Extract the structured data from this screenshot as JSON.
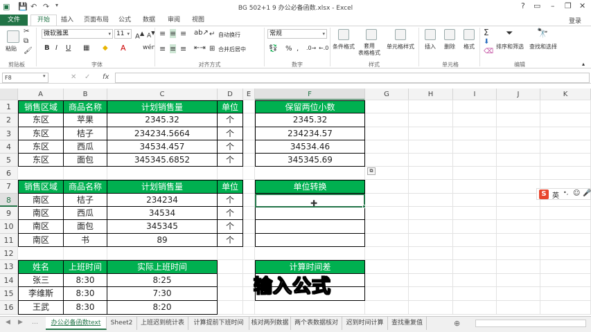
{
  "window": {
    "title": "BG 502+1 9 办公必备函数.xlsx - Excel",
    "login": "登录"
  },
  "quick_access": {
    "save_icon": "save-icon",
    "undo_icon": "undo-icon",
    "redo_icon": "redo-icon"
  },
  "ribbon_tabs": [
    "文件",
    "开始",
    "插入",
    "页面布局",
    "公式",
    "数据",
    "审阅",
    "视图"
  ],
  "ribbon": {
    "clipboard": {
      "paste": "粘贴",
      "label": "剪贴板"
    },
    "font": {
      "name": "微软雅黑",
      "size": "11",
      "label": "字体"
    },
    "alignment": {
      "wrap": "自动换行",
      "merge": "合并后居中",
      "label": "对齐方式"
    },
    "number": {
      "format": "常规",
      "label": "数字"
    },
    "styles": {
      "conditional": "条件格式",
      "table": "套用\n表格格式",
      "cell": "单元格样式",
      "label": "样式"
    },
    "cells": {
      "insert": "插入",
      "delete": "删除",
      "format": "格式",
      "label": "单元格"
    },
    "editing": {
      "sort": "排序和筛选",
      "find": "查找和选择",
      "label": "编辑"
    }
  },
  "formula_bar": {
    "name_box": "F8",
    "fx": "fx",
    "value": ""
  },
  "columns": [
    "A",
    "B",
    "C",
    "D",
    "E",
    "F",
    "G",
    "H",
    "I",
    "J",
    "K"
  ],
  "rows": [
    "1",
    "2",
    "3",
    "4",
    "5",
    "6",
    "7",
    "8",
    "9",
    "10",
    "11",
    "12",
    "13",
    "14",
    "15",
    "16"
  ],
  "table1": {
    "headers": [
      "销售区域",
      "商品名称",
      "计划销售量",
      "单位"
    ],
    "rows": [
      [
        "东区",
        "苹果",
        "2345.32",
        "个"
      ],
      [
        "东区",
        "桔子",
        "234234.5664",
        "个"
      ],
      [
        "东区",
        "西瓜",
        "34534.457",
        "个"
      ],
      [
        "东区",
        "面包",
        "345345.6852",
        "个"
      ]
    ]
  },
  "table_round": {
    "header": "保留两位小数",
    "values": [
      "2345.32",
      "234234.57",
      "34534.46",
      "345345.69"
    ]
  },
  "table2": {
    "headers": [
      "销售区域",
      "商品名称",
      "计划销售量",
      "单位"
    ],
    "rows": [
      [
        "南区",
        "桔子",
        "234234",
        "个"
      ],
      [
        "南区",
        "西瓜",
        "34534",
        "个"
      ],
      [
        "南区",
        "面包",
        "345345",
        "个"
      ],
      [
        "南区",
        "书",
        "89",
        "个"
      ]
    ]
  },
  "table_unit": {
    "header": "单位转换",
    "values": [
      "",
      "",
      "",
      ""
    ]
  },
  "table3": {
    "headers": [
      "姓名",
      "上班时间",
      "实际上班时间"
    ],
    "rows": [
      [
        "张三",
        "8:30",
        "8:25"
      ],
      [
        "李维斯",
        "8:30",
        "7:30"
      ],
      [
        "王武",
        "8:30",
        "8:20"
      ]
    ]
  },
  "table_time": {
    "header": "计算时间差",
    "values": [
      "",
      ""
    ]
  },
  "subtitle": "输入公式",
  "ime": {
    "logo": "S",
    "lang": "英"
  },
  "sheet_tabs": [
    "办公必备函数text",
    "Sheet2",
    "上班迟到统计表",
    "计算提前下班时间",
    "核对两列数据",
    "两个表数据核对",
    "迟到时间计算",
    "查找重复值"
  ],
  "active_sheet": "办公必备函数text"
}
